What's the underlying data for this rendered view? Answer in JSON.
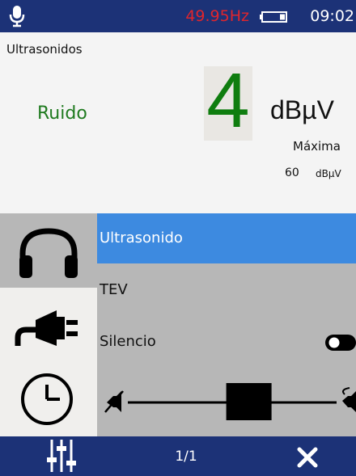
{
  "status_bar": {
    "frequency": "49.95Hz",
    "time": "09:02",
    "colors": {
      "background": "#1c3277",
      "frequency": "#e0252c"
    }
  },
  "measurement": {
    "mode_title": "Ultrasonidos",
    "noise_label": "Ruido",
    "value": "4",
    "unit": "dBµV",
    "max_label": "Máxima",
    "max_value": "60",
    "max_unit": "dBµV",
    "colors": {
      "value": "#0f7d0f",
      "noise_label": "#1f7a1f"
    }
  },
  "side_icons": [
    "headphones-icon",
    "plug-icon",
    "clock-icon"
  ],
  "menu": {
    "items": [
      {
        "label": "Ultrasonido",
        "selected": true
      },
      {
        "label": "TEV",
        "selected": false
      },
      {
        "label": "Silencio",
        "selected": false,
        "toggle_on": true
      }
    ],
    "volume": {
      "level": 0.58
    },
    "colors": {
      "selected": "#3d8ae0",
      "background": "#b7b7b7"
    }
  },
  "bottom_bar": {
    "page": "1/1",
    "left_icon": "sliders-icon",
    "right_icon": "close-icon"
  }
}
